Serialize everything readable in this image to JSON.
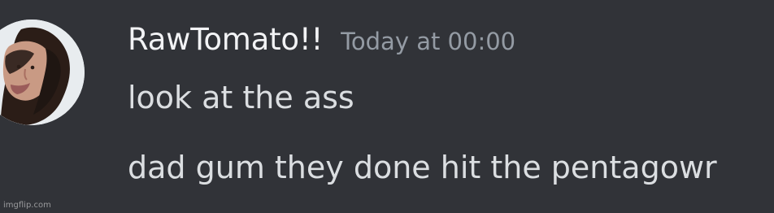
{
  "message": {
    "username": "RawTomato!!",
    "timestamp": "Today at 00:00",
    "lines": [
      "look at the ass",
      "dad gum they done hit the pentagowr"
    ],
    "avatar": {
      "icon": "avatar-photo"
    }
  },
  "watermark": {
    "text": "imgflip.com"
  },
  "colors": {
    "background": "#313338",
    "username": "#f2f3f5",
    "timestamp": "#949ba4",
    "message_text": "#dbdee1"
  }
}
